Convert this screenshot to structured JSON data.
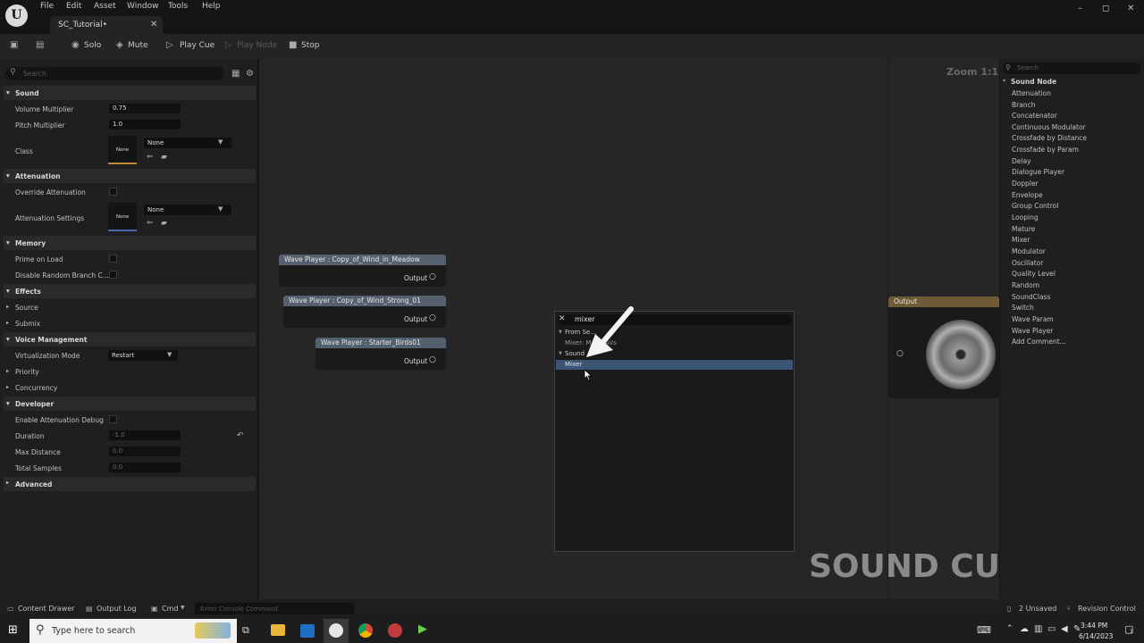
{
  "titlebar": {
    "menus": [
      "File",
      "Edit",
      "Asset",
      "Window",
      "Tools",
      "Help"
    ],
    "tab_title": "SC_Tutorial•",
    "tab_close": "✕",
    "win_min": "–",
    "win_max": "◻",
    "win_close": "✕"
  },
  "toolbar": {
    "solo": "Solo",
    "mute": "Mute",
    "play_cue": "Play Cue",
    "play_node": "Play Node",
    "stop": "Stop"
  },
  "details": {
    "search_placeholder": "Search",
    "sections": {
      "sound": "Sound",
      "attenuation": "Attenuation",
      "memory": "Memory",
      "effects": "Effects",
      "voice": "Voice Management",
      "developer": "Developer",
      "advanced": "Advanced"
    },
    "rows": {
      "volume_label": "Volume Multiplier",
      "volume_value": "0.75",
      "pitch_label": "Pitch Multiplier",
      "pitch_value": "1.0",
      "class_label": "Class",
      "class_thumb": "None",
      "class_combo": "None",
      "override_label": "Override Attenuation",
      "att_settings_label": "Attenuation Settings",
      "att_thumb": "None",
      "att_combo": "None",
      "prime_label": "Prime on Load",
      "disable_random_label": "Disable Random Branch C...",
      "source_label": "Source",
      "submix_label": "Submix",
      "virt_label": "Virtualization Mode",
      "virt_value": "Restart",
      "priority_label": "Priority",
      "concurrency_label": "Concurrency",
      "enable_debug_label": "Enable Attenuation Debug",
      "duration_label": "Duration",
      "duration_value": "-1.0",
      "max_distance_label": "Max Distance",
      "max_distance_value": "0.0",
      "total_samples_label": "Total Samples",
      "total_samples_value": "0.0"
    }
  },
  "graph": {
    "zoom": "Zoom 1:1",
    "nodes": [
      {
        "title": "Wave Player : Copy_of_Wind_in_Meadow",
        "output": "Output"
      },
      {
        "title": "Wave Player : Copy_of_Wind_Strong_01",
        "output": "Output"
      },
      {
        "title": "Wave Player : Starter_Birds01",
        "output": "Output"
      }
    ],
    "output_node": "Output",
    "watermark": "SOUND CUE"
  },
  "popup": {
    "search_value": "mixer",
    "cat_from_selection": "From Se...",
    "item_mixer_wavs": "Mixer: M... WAVs",
    "cat_sound": "Sound",
    "item_mixer": "Mixer"
  },
  "palette": {
    "search_placeholder": "Search",
    "category": "Sound Node",
    "items": [
      "Attenuation",
      "Branch",
      "Concatenator",
      "Continuous Modulator",
      "Crossfade by Distance",
      "Crossfade by Param",
      "Delay",
      "Dialogue Player",
      "Doppler",
      "Envelope",
      "Group Control",
      "Looping",
      "Mature",
      "Mixer",
      "Modulator",
      "Oscillator",
      "Quality Level",
      "Random",
      "SoundClass",
      "Switch",
      "Wave Param",
      "Wave Player",
      "Add Comment..."
    ]
  },
  "statusbar": {
    "content_drawer": "Content Drawer",
    "output_log": "Output Log",
    "cmd": "Cmd",
    "console_placeholder": "Enter Console Command",
    "unsaved": "2 Unsaved",
    "revision": "Revision Control"
  },
  "taskbar": {
    "search_placeholder": "Type here to search",
    "time": "3:44 PM",
    "date": "6/14/2023",
    "notif_count": "1"
  }
}
